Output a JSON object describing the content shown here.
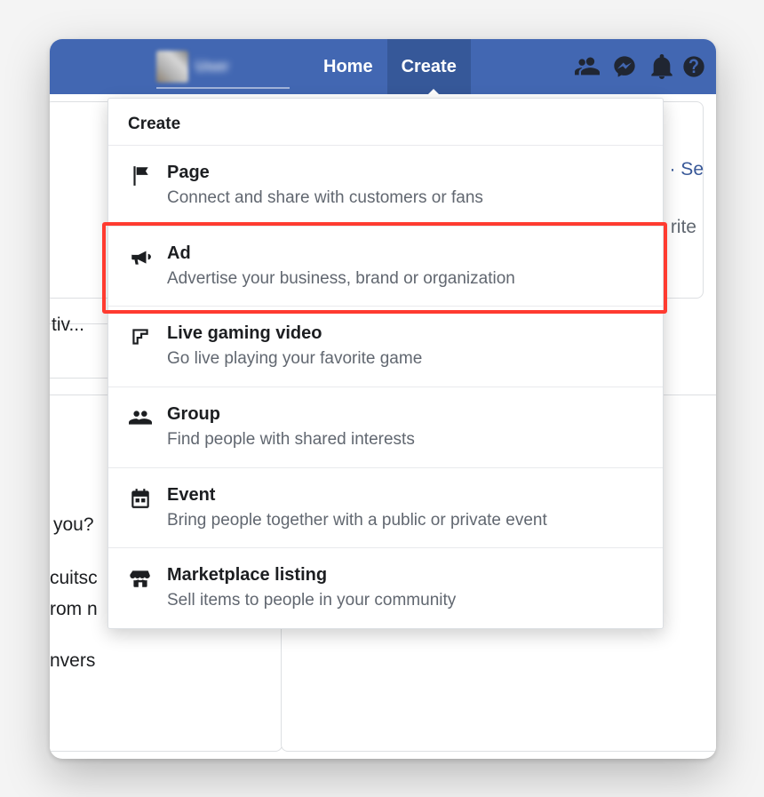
{
  "nav": {
    "home_label": "Home",
    "create_label": "Create",
    "profile_name_placeholder": "User"
  },
  "dropdown": {
    "header": "Create",
    "items": [
      {
        "icon": "flag-icon",
        "title": "Page",
        "sub": "Connect and share with customers or fans"
      },
      {
        "icon": "megaphone-icon",
        "title": "Ad",
        "sub": "Advertise your business, brand or organization"
      },
      {
        "icon": "gaming-icon",
        "title": "Live gaming video",
        "sub": "Go live playing your favorite game"
      },
      {
        "icon": "group-icon",
        "title": "Group",
        "sub": "Find people with shared interests"
      },
      {
        "icon": "calendar-icon",
        "title": "Event",
        "sub": "Bring people together with a public or private event"
      },
      {
        "icon": "marketplace-icon",
        "title": "Marketplace listing",
        "sub": "Sell items to people in your community"
      }
    ]
  },
  "background": {
    "link_fragment_1": "e · Se",
    "text_fragment_1": "rite",
    "text_fragment_2": "tiv...",
    "text_fragment_3": "you?",
    "text_fragment_4": "cuitsc",
    "text_fragment_5": "rom n",
    "text_fragment_6": "nvers"
  },
  "highlighted_item_index": 1
}
